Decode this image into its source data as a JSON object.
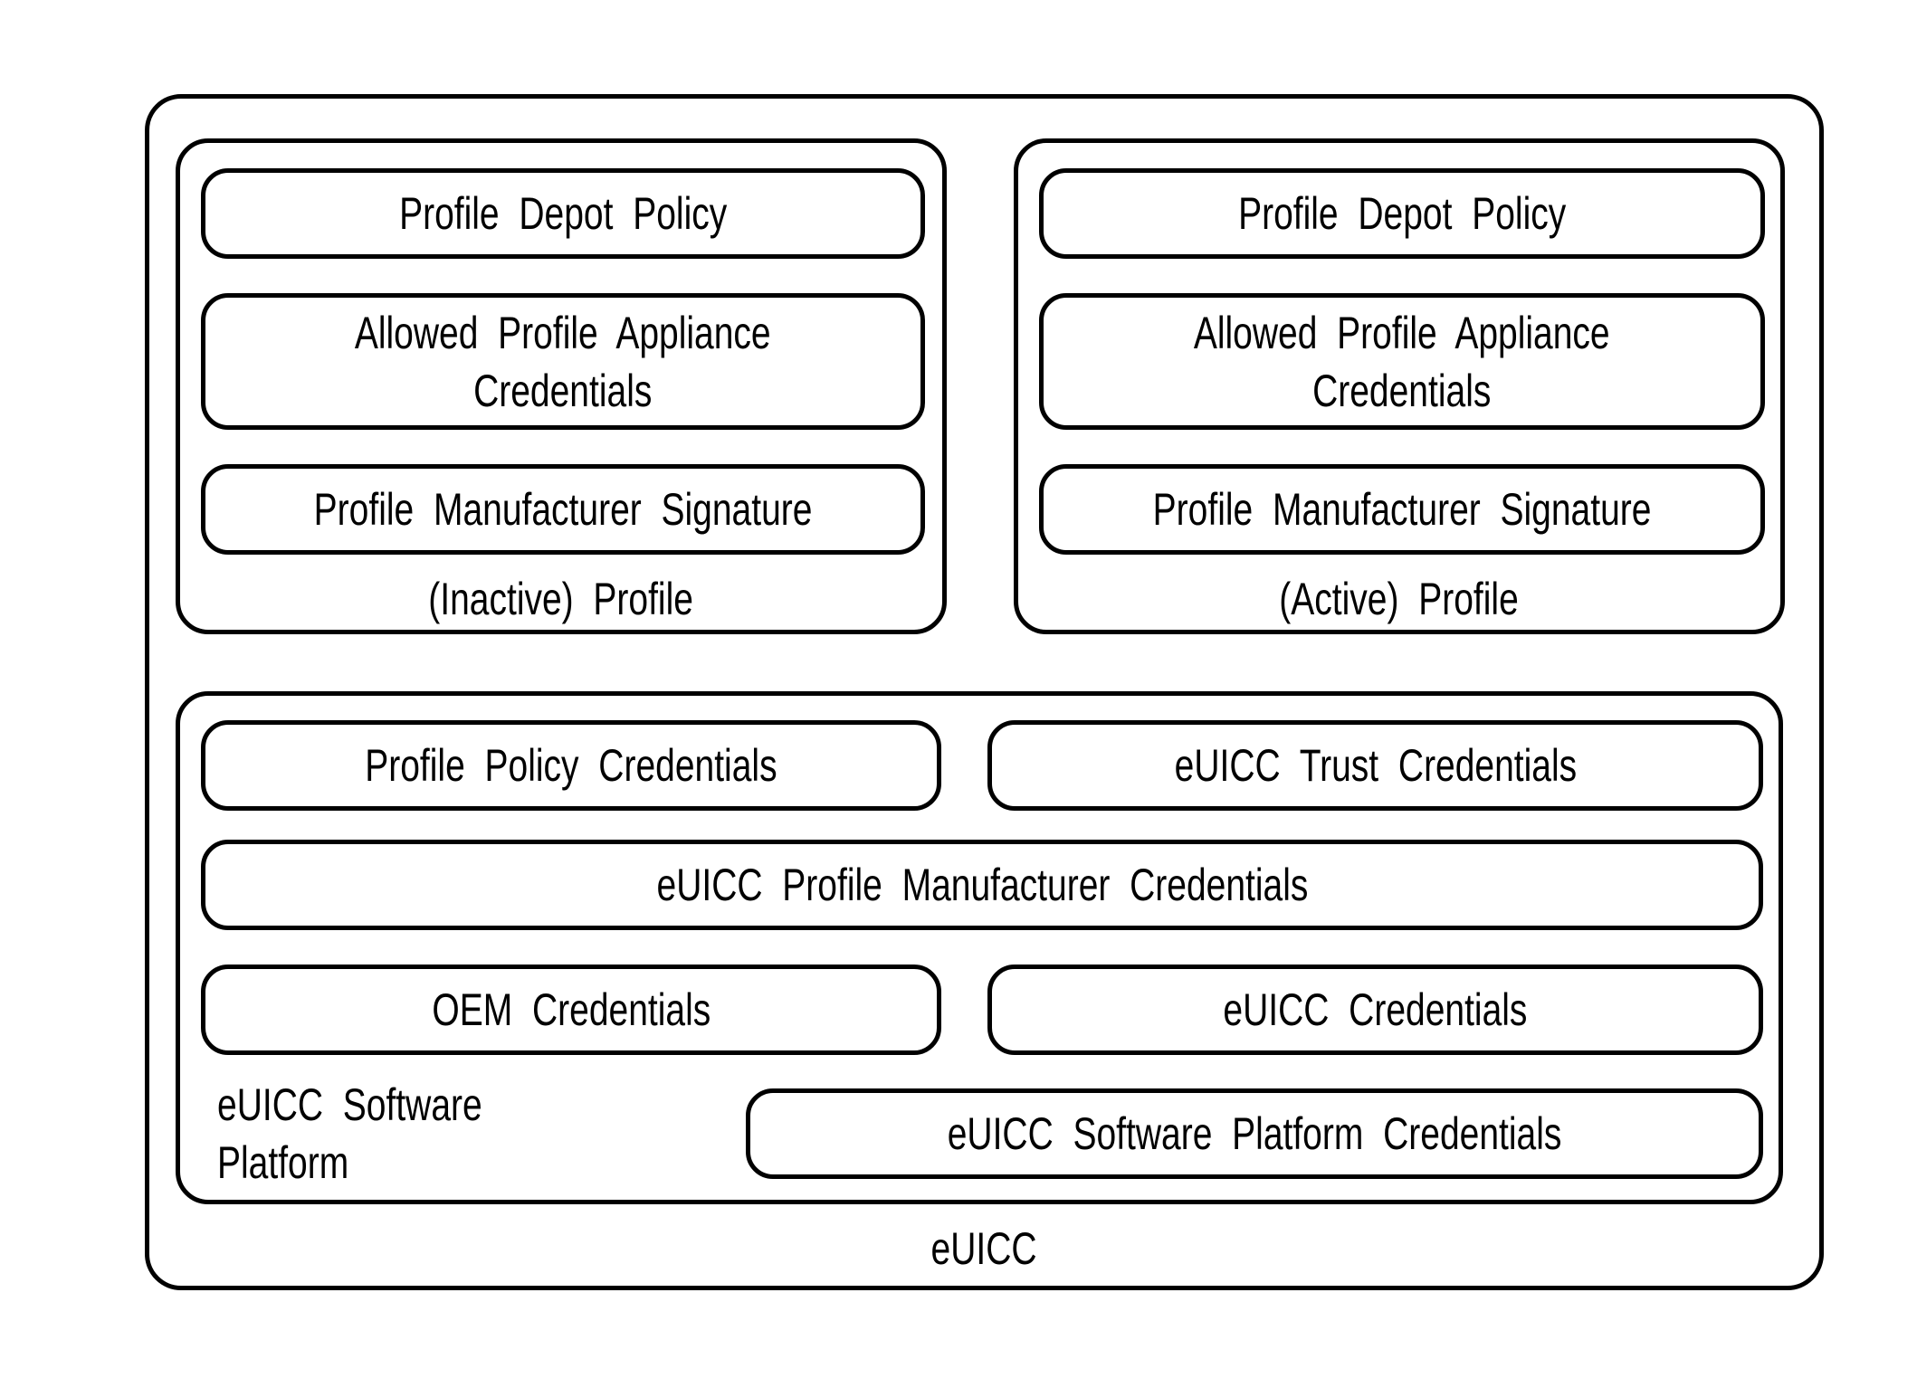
{
  "diagram": {
    "outer_label": "eUICC",
    "profiles": [
      {
        "label": "(Inactive) Profile",
        "items": [
          "Profile Depot Policy",
          "Allowed Profile Appliance\nCredentials",
          "Profile Manufacturer Signature"
        ]
      },
      {
        "label": "(Active) Profile",
        "items": [
          "Profile Depot Policy",
          "Allowed Profile Appliance\nCredentials",
          "Profile Manufacturer Signature"
        ]
      }
    ],
    "platform": {
      "label": "eUICC Software Platform",
      "profile_policy_credentials": "Profile Policy Credentials",
      "trust_credentials": "eUICC Trust Credentials",
      "profile_manufacturer_credentials": "eUICC Profile Manufacturer Credentials",
      "oem_credentials": "OEM Credentials",
      "euicc_credentials": "eUICC Credentials",
      "software_platform_credentials": "eUICC Software Platform Credentials"
    }
  }
}
